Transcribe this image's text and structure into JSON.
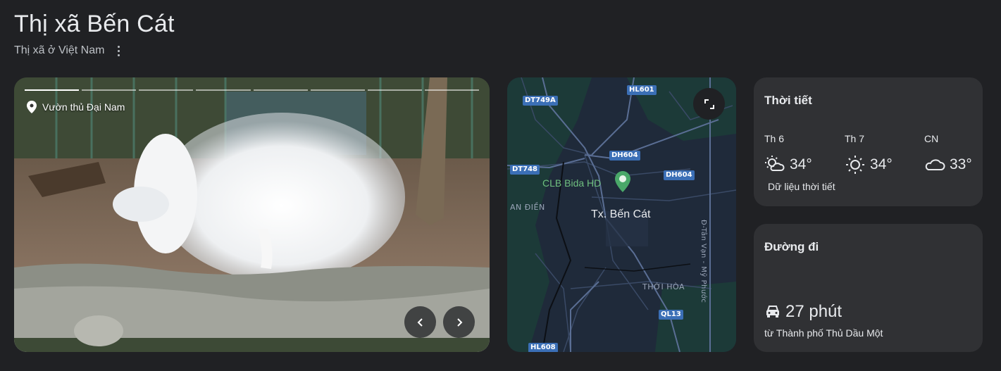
{
  "header": {
    "title": "Thị xã Bến Cát",
    "subtitle": "Thị xã ở Việt Nam"
  },
  "photo": {
    "location_label": "Vườn thủ Đại Nam",
    "slide_count": 8,
    "active_slide": 1
  },
  "map": {
    "town_label": "Tx. Bến Cát",
    "poi_label": "CLB Bida HD",
    "area_labels": [
      "AN ĐIỀN",
      "THỚI HÒA"
    ],
    "vertical_road_label": "Đ-Tân Vạn - Mỹ Phước",
    "road_badges": [
      "DT749A",
      "HL601",
      "DH604",
      "DT748",
      "DH604",
      "QL13",
      "HL608"
    ]
  },
  "weather": {
    "title": "Thời tiết",
    "days": [
      {
        "name": "Th 6",
        "temp": "34°",
        "icon": "partly-sunny-icon"
      },
      {
        "name": "Th 7",
        "temp": "34°",
        "icon": "sunny-icon"
      },
      {
        "name": "CN",
        "temp": "33°",
        "icon": "cloudy-icon"
      }
    ],
    "source": "Dữ liệu thời tiết"
  },
  "route": {
    "title": "Đường đi",
    "time": "27 phút",
    "from": "từ Thành phố Thủ Dầu Một"
  },
  "colors": {
    "background": "#202124",
    "card": "#303134",
    "map_bg": "#1f2a3a",
    "road_badge": "#3b6fb6"
  }
}
